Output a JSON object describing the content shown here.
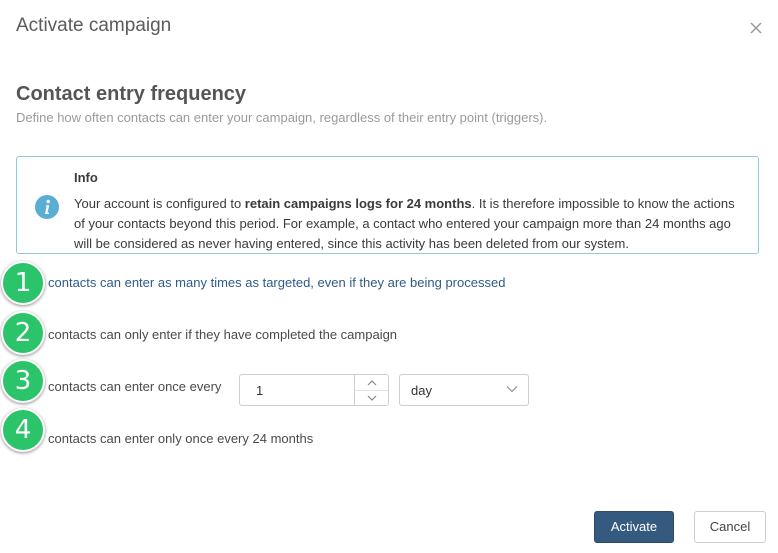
{
  "modal": {
    "title": "Activate campaign",
    "close_icon": "close-icon"
  },
  "section": {
    "title": "Contact entry frequency",
    "subtitle": "Define how often contacts can enter your campaign, regardless of their entry point (triggers)."
  },
  "info": {
    "icon": "info-icon",
    "title": "Info",
    "text_before": "Your account is configured to ",
    "text_bold": "retain campaigns logs for 24 months",
    "text_after": ". It is therefore impossible to know the actions of your contacts beyond this period. For example, a contact who entered your campaign more than 24 months ago will be considered as never having entered, since this activity has been deleted from our system."
  },
  "options": [
    {
      "number": "1",
      "label": "contacts can enter as many times as targeted, even if they are being processed"
    },
    {
      "number": "2",
      "label": "contacts can only enter if they have completed the campaign"
    },
    {
      "number": "3",
      "label": "contacts can enter once every"
    },
    {
      "number": "4",
      "label": "contacts can enter only once every 24 months"
    }
  ],
  "frequency": {
    "value": "1",
    "unit": "day"
  },
  "footer": {
    "activate_label": "Activate",
    "cancel_label": "Cancel"
  },
  "colors": {
    "badge_green": "#2bc46b",
    "primary_button": "#355a80",
    "info_border": "#8ecbdc",
    "info_icon": "#5aaed3",
    "selected_option_text": "#2f5a88"
  }
}
